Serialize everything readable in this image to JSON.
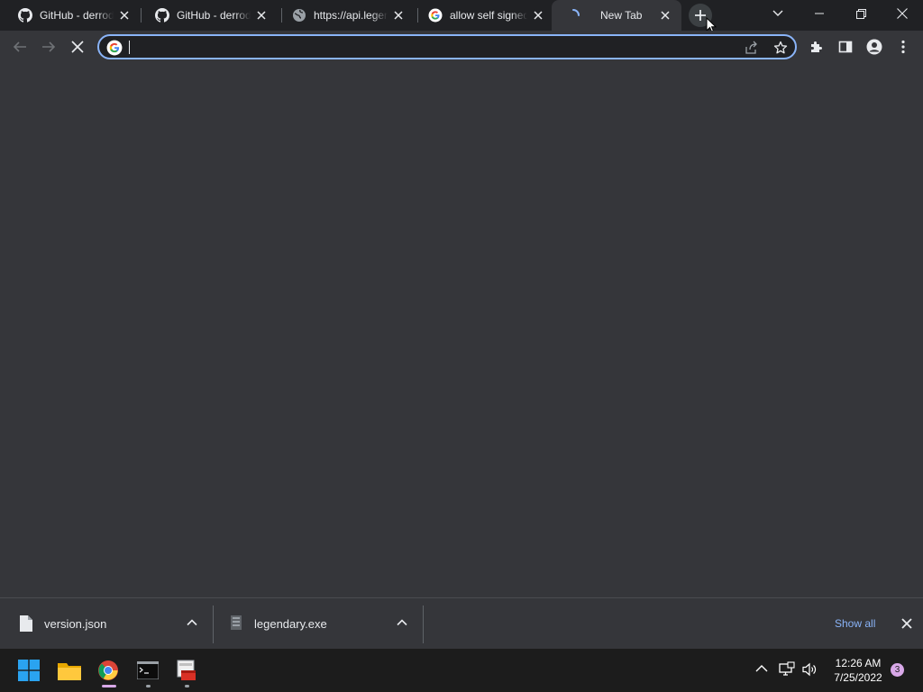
{
  "tabs": [
    {
      "title": "GitHub - derrod/legendary",
      "favicon": "github-icon"
    },
    {
      "title": "GitHub - derrod/legendary",
      "favicon": "github-icon"
    },
    {
      "title": "https://api.legendary.gl",
      "favicon": "globe-icon"
    },
    {
      "title": "allow self signed",
      "favicon": "google-icon"
    },
    {
      "title": "New Tab",
      "favicon": "loading-spinner-icon",
      "active": true
    }
  ],
  "omnibox": {
    "value": "",
    "placeholder": ""
  },
  "downloads": [
    {
      "name": "version.json",
      "icon": "file-icon"
    },
    {
      "name": "legendary.exe",
      "icon": "exe-file-icon"
    }
  ],
  "shelf": {
    "show_all_label": "Show all"
  },
  "taskbar": {
    "apps": [
      "windows-start-icon",
      "file-explorer-icon",
      "chrome-icon",
      "terminal-icon",
      "app-icon"
    ],
    "time": "12:26 AM",
    "date": "7/25/2022",
    "notification_count": "3"
  },
  "colors": {
    "accent": "#8ab4f8",
    "tabstrip_bg": "#202124",
    "toolbar_bg": "#35363a",
    "taskbar_bg": "#1c1c1c"
  }
}
